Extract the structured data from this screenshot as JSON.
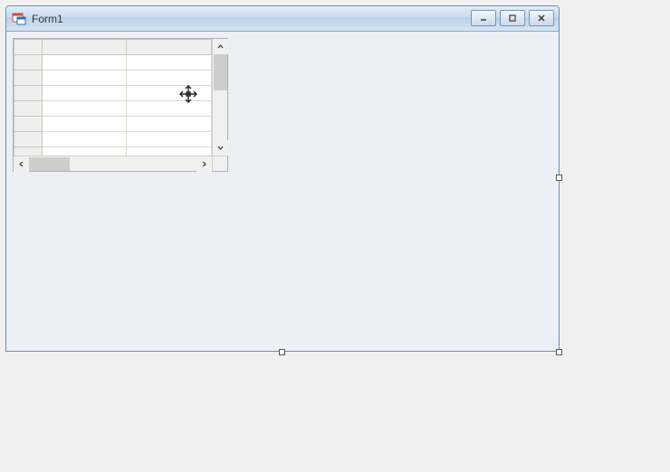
{
  "window": {
    "title": "Form1"
  },
  "grid": {
    "rows": 7,
    "cols": 2
  }
}
